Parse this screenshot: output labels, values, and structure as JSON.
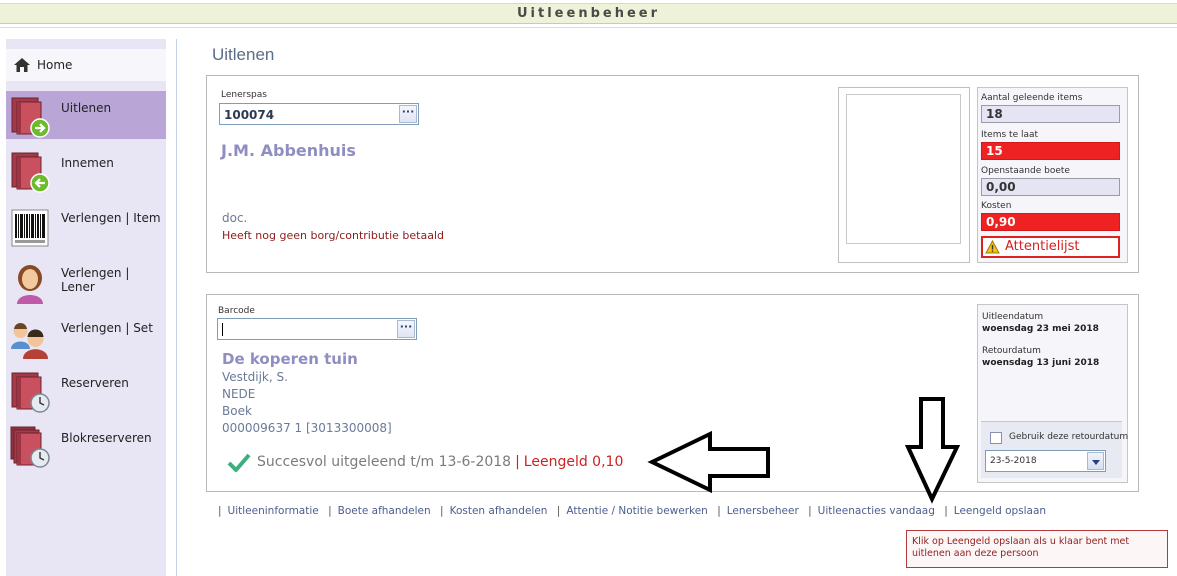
{
  "app": {
    "title": "Uitleenbeheer"
  },
  "sidebar": {
    "items": [
      {
        "label": "Home",
        "icon": "home-icon"
      },
      {
        "label": "Uitlenen",
        "icon": "book-out-icon",
        "active": true
      },
      {
        "label": "Innemen",
        "icon": "book-in-icon"
      },
      {
        "label": "Verlengen | Item",
        "icon": "barcode-icon"
      },
      {
        "label": "Verlengen | Lener",
        "icon": "user-female-icon"
      },
      {
        "label": "Verlengen | Set",
        "icon": "users-icon"
      },
      {
        "label": "Reserveren",
        "icon": "book-clock-icon"
      },
      {
        "label": "Blokreserveren",
        "icon": "books-clock-icon"
      }
    ]
  },
  "page": {
    "title": "Uitlenen"
  },
  "lener": {
    "pas_label": "Lenerspas",
    "pas_value": "100074",
    "name": "J.M. Abbenhuis",
    "type": "doc.",
    "notice": "Heeft nog geen borg/contributie betaald"
  },
  "stats": {
    "items_label": "Aantal geleende items",
    "items_value": "18",
    "late_label": "Items te laat",
    "late_value": "15",
    "fine_label": "Openstaande boete",
    "fine_value": "0,00",
    "cost_label": "Kosten",
    "cost_value": "0,90",
    "attention": "Attentielijst"
  },
  "item": {
    "barcode_label": "Barcode",
    "barcode_value": "",
    "title": "De koperen tuin",
    "author": "Vestdijk, S.",
    "lang": "NEDE",
    "kind": "Boek",
    "code": "000009637 1 [3013300008]",
    "success": "Succesvol uitgeleend t/m 13-6-2018",
    "separator": "|",
    "fee": "Leengeld 0,10"
  },
  "dates": {
    "lend_label": "Uitleendatum",
    "lend_value": "woensdag 23 mei 2018",
    "return_label": "Retourdatum",
    "return_value": "woensdag 13 juni 2018",
    "use_label": "Gebruik deze retourdatum",
    "select_value": "23-5-2018"
  },
  "links": [
    "Uitleeninformatie",
    "Boete afhandelen",
    "Kosten afhandelen",
    "Attentie / Notitie bewerken",
    "Lenersbeheer",
    "Uitleenacties vandaag",
    "Leengeld opslaan"
  ],
  "tooltip": "Klik op Leengeld opslaan als u klaar bent met uitlenen aan deze persoon",
  "colors": {
    "accent": "#b9a6d6",
    "alert": "#ee2222",
    "name": "#8f8ec1"
  }
}
